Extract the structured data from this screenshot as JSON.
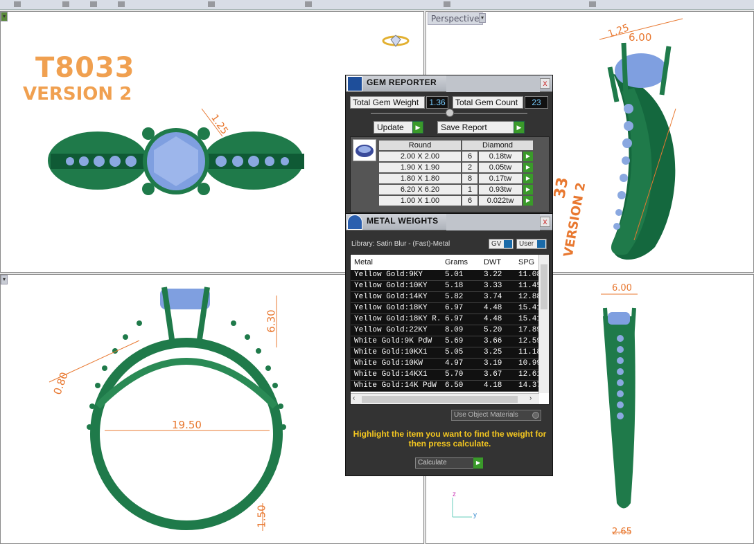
{
  "viewports": {
    "perspective_label": "Perspective"
  },
  "drawing": {
    "title": "T8033",
    "subtitle": "VERSION 2",
    "persp_text_1": "33",
    "persp_text_2": "VERSION 2",
    "dims": {
      "top_prong": "1.25",
      "persp_a": "1.25",
      "persp_b": "6.00",
      "front_height": "6.30",
      "front_side": "0.80",
      "front_inner": "19.50",
      "front_shank": "1.50",
      "right_top": "6.00",
      "right_bottom": "2.65"
    },
    "axis": {
      "z": "z",
      "y": "y"
    }
  },
  "gem_reporter": {
    "title": "GEM REPORTER",
    "close": "x",
    "total_weight_label": "Total Gem Weight",
    "total_weight_value": "1.36",
    "total_count_label": "Total Gem Count",
    "total_count_value": "23",
    "update_label": "Update",
    "save_label": "Save Report",
    "shape_header": "Round",
    "material_header": "Diamond",
    "rows": [
      {
        "size": "2.00 X 2.00",
        "count": "6",
        "weight": "0.18tw"
      },
      {
        "size": "1.90 X 1.90",
        "count": "2",
        "weight": "0.05tw"
      },
      {
        "size": "1.80 X 1.80",
        "count": "8",
        "weight": "0.17tw"
      },
      {
        "size": "6.20 X 6.20",
        "count": "1",
        "weight": "0.93tw"
      },
      {
        "size": "1.00 X 1.00",
        "count": "6",
        "weight": "0.022tw"
      }
    ]
  },
  "metal_weights": {
    "title": "METAL WEIGHTS",
    "close": "x",
    "library": "Library: Satin Blur - (Fast)-Metal",
    "gv_label": "GV",
    "user_label": "User",
    "columns": [
      "Metal",
      "Grams",
      "DWT",
      "SPG"
    ],
    "rows": [
      {
        "metal": "Yellow Gold:9KY",
        "grams": "5.01",
        "dwt": "3.22",
        "spg": "11.08"
      },
      {
        "metal": "Yellow Gold:10KY",
        "grams": "5.18",
        "dwt": "3.33",
        "spg": "11.45"
      },
      {
        "metal": "Yellow Gold:14KY",
        "grams": "5.82",
        "dwt": "3.74",
        "spg": "12.88"
      },
      {
        "metal": "Yellow Gold:18KY",
        "grams": "6.97",
        "dwt": "4.48",
        "spg": "15.41"
      },
      {
        "metal": "Yellow Gold:18KY R...",
        "grams": "6.97",
        "dwt": "4.48",
        "spg": "15.41"
      },
      {
        "metal": "Yellow Gold:22KY",
        "grams": "8.09",
        "dwt": "5.20",
        "spg": "17.89"
      },
      {
        "metal": "White Gold:9K PdW",
        "grams": "5.69",
        "dwt": "3.66",
        "spg": "12.59"
      },
      {
        "metal": "White Gold:10KX1",
        "grams": "5.05",
        "dwt": "3.25",
        "spg": "11.18"
      },
      {
        "metal": "White Gold:10KW",
        "grams": "4.97",
        "dwt": "3.19",
        "spg": "10.99"
      },
      {
        "metal": "White Gold:14KX1",
        "grams": "5.70",
        "dwt": "3.67",
        "spg": "12.61"
      },
      {
        "metal": "White Gold:14K PdW",
        "grams": "6.50",
        "dwt": "4.18",
        "spg": "14.37"
      }
    ],
    "use_object_materials": "Use Object Materials",
    "hint": "Highlight the item you want to find the weight for then press calculate.",
    "calculate_label": "Calculate"
  }
}
